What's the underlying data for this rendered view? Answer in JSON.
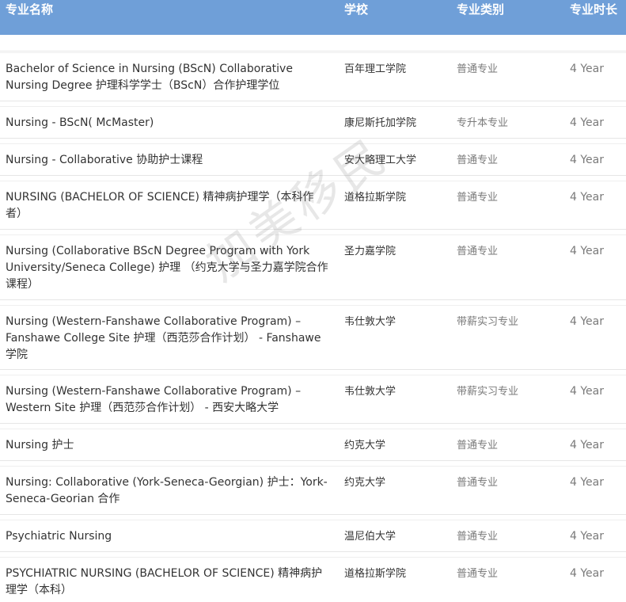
{
  "header": {
    "name": "专业名称",
    "school": "学校",
    "type": "专业类别",
    "duration": "专业时长"
  },
  "rows": [
    {
      "name": "Bachelor of Science in Nursing (BScN) Collaborative Nursing Degree 护理科学学士（BScN）合作护理学位",
      "school": "百年理工学院",
      "type": "普通专业",
      "duration": "4 Year"
    },
    {
      "name": "Nursing - BScN( McMaster)",
      "school": "康尼斯托加学院",
      "type": "专升本专业",
      "duration": "4 Year"
    },
    {
      "name": "Nursing - Collaborative 协助护士课程",
      "school": "安大略理工大学",
      "type": "普通专业",
      "duration": "4 Year"
    },
    {
      "name": "NURSING (BACHELOR OF SCIENCE) 精神病护理学（本科作者）",
      "school": "道格拉斯学院",
      "type": "普通专业",
      "duration": "4 Year"
    },
    {
      "name": "Nursing (Collaborative BScN Degree Program with York University/Seneca College) 护理 （约克大学与圣力嘉学院合作课程）",
      "school": "圣力嘉学院",
      "type": "普通专业",
      "duration": "4 Year"
    },
    {
      "name": "Nursing (Western-Fanshawe Collaborative Program) – Fanshawe College Site 护理（西范莎合作计划） - Fanshawe学院",
      "school": "韦仕敦大学",
      "type": "带薪实习专业",
      "duration": "4 Year"
    },
    {
      "name": "Nursing (Western-Fanshawe Collaborative Program) – Western Site 护理（西范莎合作计划） - 西安大略大学",
      "school": "韦仕敦大学",
      "type": "带薪实习专业",
      "duration": "4 Year"
    },
    {
      "name": "Nursing 护士",
      "school": "约克大学",
      "type": "普通专业",
      "duration": "4 Year"
    },
    {
      "name": "Nursing: Collaborative (York-Seneca-Georgian) 护士：York-Seneca-Georian 合作",
      "school": "约克大学",
      "type": "普通专业",
      "duration": "4 Year"
    },
    {
      "name": "Psychiatric Nursing",
      "school": "温尼伯大学",
      "type": "普通专业",
      "duration": "4 Year"
    },
    {
      "name": "PSYCHIATRIC NURSING (BACHELOR OF SCIENCE) 精神病护理学（本科）",
      "school": "道格拉斯学院",
      "type": "普通专业",
      "duration": "4 Year"
    }
  ],
  "watermark": "加美移民"
}
